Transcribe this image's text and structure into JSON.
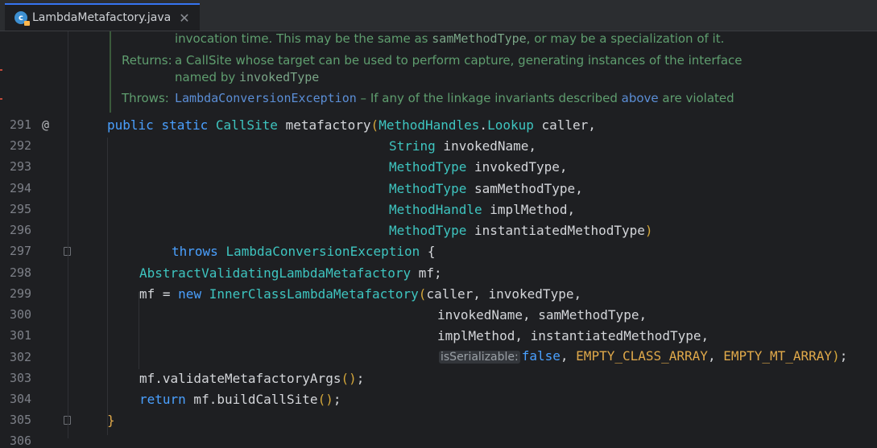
{
  "tab": {
    "file_name": "LambdaMetafactory.java",
    "icon": "java-class-icon",
    "close_glyph": "✕"
  },
  "doc": {
    "line1_text": "invocation time. This may be the same as ",
    "line1_code": "samMethodType",
    "line1_tail": ", or may be a specialization of it.",
    "returns_label": "Returns:",
    "returns_text": "a CallSite whose target can be used to perform capture, generating instances of the interface",
    "returns_text2": "named by ",
    "returns_code": "invokedType",
    "throws_label": "Throws:",
    "throws_link": "LambdaConversionException",
    "throws_text": " – If any of the linkage invariants described ",
    "throws_above": "above",
    "throws_tail": " are violated"
  },
  "gutter": {
    "line_numbers": [
      "291",
      "292",
      "293",
      "294",
      "295",
      "296",
      "297",
      "298",
      "299",
      "300",
      "301",
      "302",
      "303",
      "304",
      "305",
      "306"
    ],
    "annotation_marker": "@"
  },
  "code": {
    "l291": {
      "public": "public",
      "static": "static",
      "type": "CallSite",
      "name": "metafactory",
      "open": "(",
      "ptype": "MethodHandles",
      "dot": ".",
      "ptype2": "Lookup",
      "pname": " caller,"
    },
    "l292": {
      "ptype": "String",
      "pname": " invokedName,"
    },
    "l293": {
      "ptype": "MethodType",
      "pname": " invokedType,"
    },
    "l294": {
      "ptype": "MethodType",
      "pname": " samMethodType,"
    },
    "l295": {
      "ptype": "MethodHandle",
      "pname": " implMethod,"
    },
    "l296": {
      "ptype": "MethodType",
      "pname": " instantiatedMethodType",
      "close": ")"
    },
    "l297": {
      "throws": "throws",
      "type": "LambdaConversionException",
      "brace": " {"
    },
    "l298": {
      "type": "AbstractValidatingLambdaMetafactory",
      "var": " mf;"
    },
    "l299": {
      "var": "mf = ",
      "new": "new",
      "type": " InnerClassLambdaMetafactory",
      "open": "(",
      "args": "caller, invokedType,"
    },
    "l300": {
      "args": "invokedName, samMethodType,"
    },
    "l301": {
      "args": "implMethod, instantiatedMethodType,"
    },
    "l302": {
      "hint": "isSerializable:",
      "false": "false",
      "c1": ", ",
      "const1": "EMPTY_CLASS_ARRAY",
      "c2": ", ",
      "const2": "EMPTY_MT_ARRAY",
      "close": ")",
      "semi": ";"
    },
    "l303": {
      "call": "mf.validateMetafactoryArgs",
      "paren": "()",
      "semi": ";"
    },
    "l304": {
      "ret": "return",
      "call": " mf.buildCallSite",
      "paren": "()",
      "semi": ";"
    },
    "l305": {
      "brace": "}"
    }
  },
  "colors": {
    "keyword": "#4aa0ff",
    "type": "#3ec5c0",
    "doc": "#5f9e6f",
    "constant": "#e0a94a",
    "background": "#1e1f22"
  }
}
